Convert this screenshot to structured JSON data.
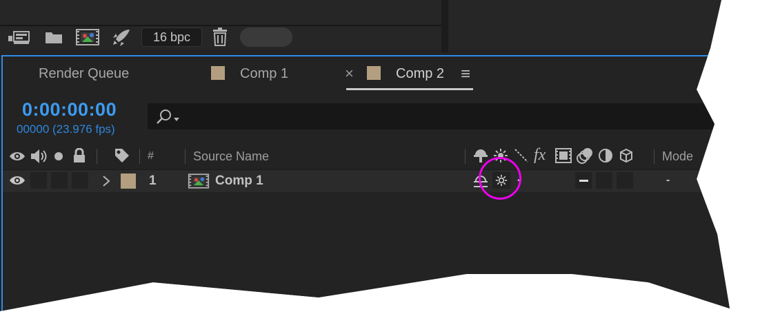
{
  "toolbar": {
    "bpc_label": "16 bpc",
    "icons": [
      "interpret-footage-icon",
      "folder-icon",
      "new-composition-icon",
      "render-rocket-icon",
      "trash-icon"
    ]
  },
  "tabs": [
    {
      "label": "Render Queue"
    },
    {
      "label": "Comp 1"
    },
    {
      "label": "Comp 2",
      "active": true
    }
  ],
  "tab_close_glyph": "×",
  "tab_menu_glyph": "≡",
  "time": {
    "timecode": "0:00:00:00",
    "frames": "00000 (23.976 fps)"
  },
  "search": {
    "icon": "search-icon"
  },
  "header": {
    "number": "#",
    "source_name": "Source Name",
    "fx": "fx",
    "mode": "Mode"
  },
  "layer": {
    "index": "1",
    "name": "Comp 1",
    "dash": "-",
    "mode_value": "-"
  },
  "colors": {
    "accent_blue": "#2d8ceb",
    "label_tan": "#b39f80",
    "highlight_magenta": "#ee00ee"
  }
}
